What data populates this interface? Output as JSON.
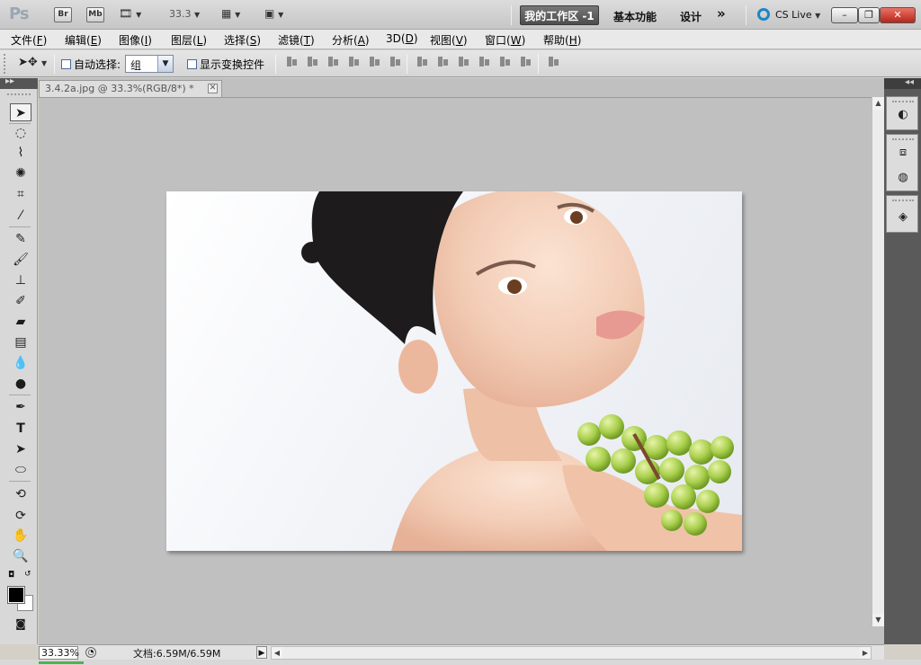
{
  "app": {
    "logo": "Ps",
    "bridge_label": "Br",
    "minibridge_label": "Mb",
    "zoom_value": "33.3",
    "workspaces": {
      "active": "我的工作区 -1",
      "essentials": "基本功能",
      "design": "设计",
      "more": "»"
    },
    "cs_live": "CS Live",
    "window_buttons": {
      "minimize": "–",
      "restore": "❐",
      "close": "✕"
    }
  },
  "menu": [
    {
      "label": "文件",
      "key": "F"
    },
    {
      "label": "编辑",
      "key": "E"
    },
    {
      "label": "图像",
      "key": "I"
    },
    {
      "label": "图层",
      "key": "L"
    },
    {
      "label": "选择",
      "key": "S"
    },
    {
      "label": "滤镜",
      "key": "T"
    },
    {
      "label": "分析",
      "key": "A"
    },
    {
      "label": "3D",
      "key": "D"
    },
    {
      "label": "视图",
      "key": "V"
    },
    {
      "label": "窗口",
      "key": "W"
    },
    {
      "label": "帮助",
      "key": "H"
    }
  ],
  "options": {
    "auto_select_label": "自动选择:",
    "auto_select_value": "组",
    "show_transform_label": "显示变换控件"
  },
  "document": {
    "tab_title": "3.4.2a.jpg @ 33.3%(RGB/8*) *",
    "close": "✕"
  },
  "status": {
    "zoom": "33.33%",
    "doc_info": "文档:6.59M/6.59M"
  },
  "colors": {
    "foreground": "#000000",
    "background": "#ffffff",
    "workspace_active_bg": "#5a5a5a",
    "cs_live_accent": "#1a86c8"
  }
}
